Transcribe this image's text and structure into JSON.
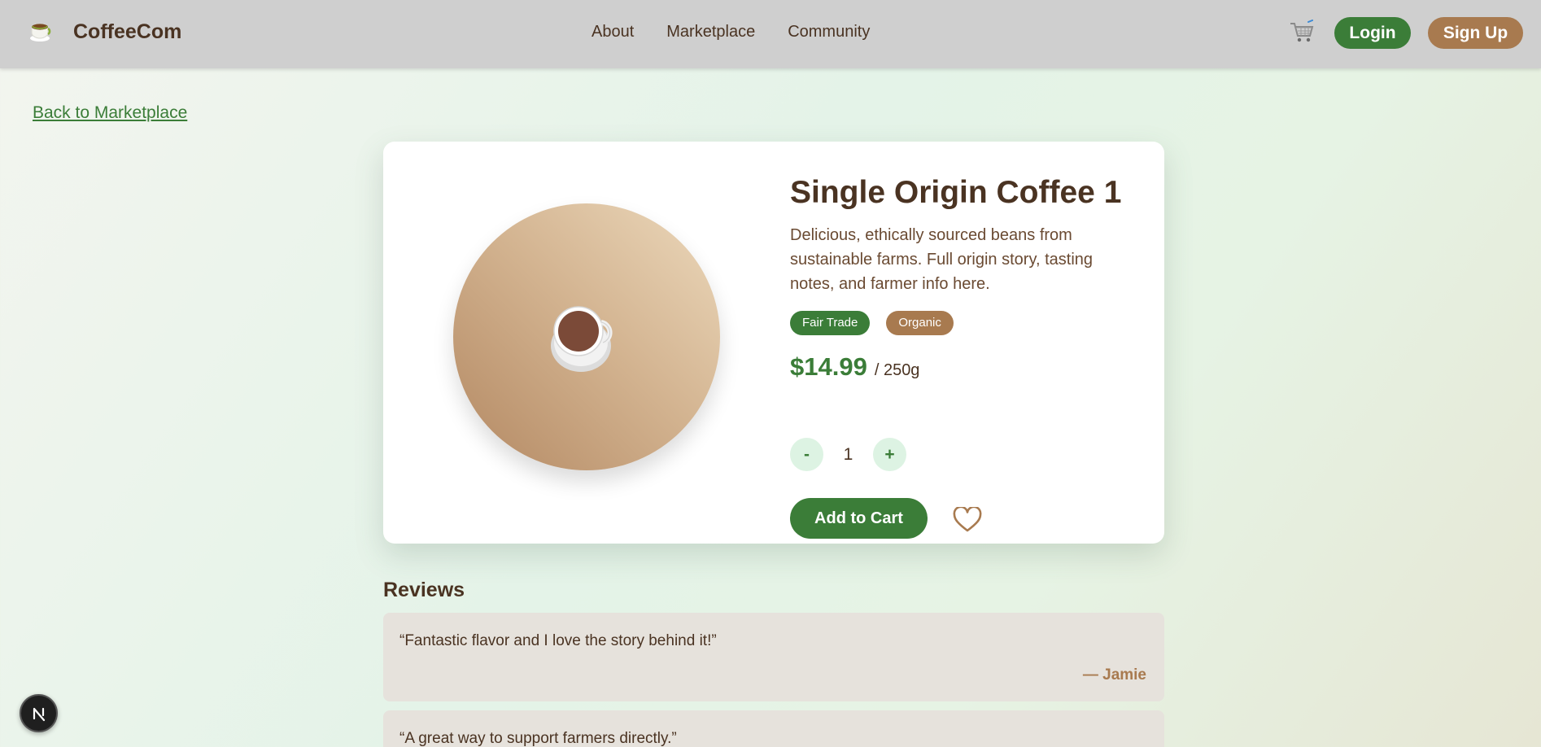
{
  "header": {
    "brand_name": "CoffeeCom",
    "nav": [
      "About",
      "Marketplace",
      "Community"
    ],
    "login_label": "Login",
    "signup_label": "Sign Up"
  },
  "back_link": "Back to Marketplace",
  "product": {
    "title": "Single Origin Coffee 1",
    "description": "Delicious, ethically sourced beans from sustainable farms. Full origin story, tasting notes, and farmer info here.",
    "tags": [
      "Fair Trade",
      "Organic"
    ],
    "price": "$14.99",
    "unit": "/ 250g",
    "quantity": "1",
    "decrement_label": "-",
    "increment_label": "+",
    "add_to_cart_label": "Add to Cart"
  },
  "reviews": {
    "heading": "Reviews",
    "items": [
      {
        "text": "“Fantastic flavor and I love the story behind it!”",
        "author": "— Jamie"
      },
      {
        "text": "“A great way to support farmers directly.”"
      }
    ]
  },
  "colors": {
    "green": "#3b7d38",
    "brown": "#a87a4f",
    "text": "#4a3322",
    "header_bg": "#cfcfcf"
  },
  "icons": {
    "logo": "coffee-cup-icon",
    "cart": "cart-icon",
    "favorite": "heart-icon",
    "badge": "n-icon"
  }
}
